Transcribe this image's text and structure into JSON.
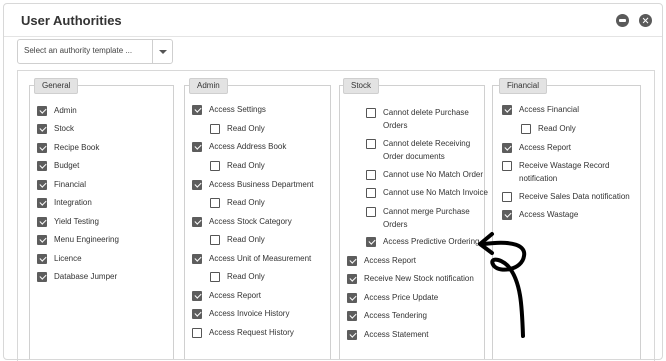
{
  "dialog": {
    "title": "User Authorities"
  },
  "header_buttons": {
    "minimize_icon": "minimize-icon",
    "close_icon": "close-icon"
  },
  "template_select": {
    "value": "Select an authority template ..."
  },
  "panels": {
    "general": {
      "title": "General",
      "items": [
        {
          "label": "Admin",
          "checked": true
        },
        {
          "label": "Stock",
          "checked": true
        },
        {
          "label": "Recipe Book",
          "checked": true
        },
        {
          "label": "Budget",
          "checked": true
        },
        {
          "label": "Financial",
          "checked": true
        },
        {
          "label": "Integration",
          "checked": true
        },
        {
          "label": "Yield Testing",
          "checked": true
        },
        {
          "label": "Menu Engineering",
          "checked": true
        },
        {
          "label": "Licence",
          "checked": true
        },
        {
          "label": "Database Jumper",
          "checked": true
        }
      ]
    },
    "admin": {
      "title": "Admin",
      "items": [
        {
          "label": "Access Settings",
          "checked": true
        },
        {
          "label": "Read Only",
          "checked": false
        },
        {
          "label": "Access Address Book",
          "checked": true
        },
        {
          "label": "Read Only",
          "checked": false
        },
        {
          "label": "Access Business Department",
          "checked": true
        },
        {
          "label": "Read Only",
          "checked": false
        },
        {
          "label": "Access Stock Category",
          "checked": true
        },
        {
          "label": "Read Only",
          "checked": false
        },
        {
          "label": "Access Unit of Measurement",
          "checked": true
        },
        {
          "label": "Read Only",
          "checked": false
        },
        {
          "label": "Access Report",
          "checked": true
        },
        {
          "label": "Access Invoice History",
          "checked": true
        },
        {
          "label": "Access Request History",
          "checked": false
        }
      ]
    },
    "stock": {
      "title": "Stock",
      "items": [
        {
          "line1": "Cannot delete Purchase",
          "line2": "Orders",
          "checked": false
        },
        {
          "line1": "Cannot delete Receiving",
          "line2": "Order documents",
          "checked": false
        },
        {
          "line1": "Cannot use No Match Order",
          "checked": false
        },
        {
          "line1": "Cannot use No Match Invoice",
          "checked": false
        },
        {
          "line1": "Cannot merge Purchase",
          "line2": "Orders",
          "checked": false
        },
        {
          "line1": "Access Predictive Ordering",
          "checked": true
        },
        {
          "line1": "Access Report",
          "checked": true
        },
        {
          "line1": "Receive New Stock notification",
          "checked": true
        },
        {
          "line1": "Access Price Update",
          "checked": true
        },
        {
          "line1": "Access Tendering",
          "checked": true
        },
        {
          "line1": "Access Statement",
          "checked": true
        }
      ]
    },
    "financial": {
      "title": "Financial",
      "items": [
        {
          "line1": "Access Financial",
          "checked": true
        },
        {
          "line1": "Read Only",
          "checked": false
        },
        {
          "line1": "Access Report",
          "checked": true
        },
        {
          "line1": "Receive Wastage Record",
          "line2": "notification",
          "checked": false
        },
        {
          "line1": "Receive Sales Data notification",
          "checked": false
        },
        {
          "line1": "Access Wastage",
          "checked": true
        }
      ]
    }
  },
  "colors": {
    "checkbox_checked": "#5d5d5d",
    "panel_header_bg": "#e3e3e3",
    "arrow": "#000000"
  }
}
